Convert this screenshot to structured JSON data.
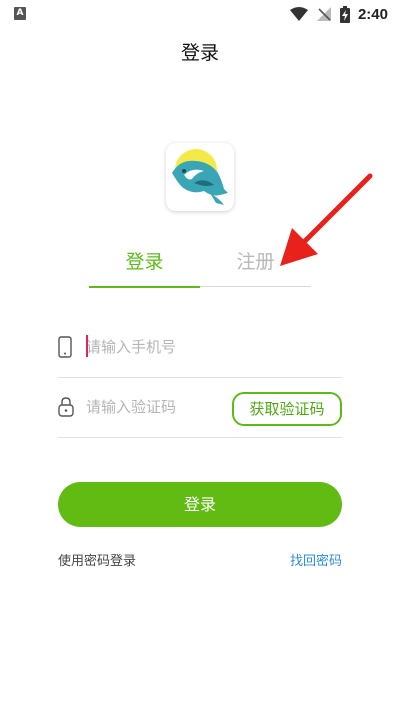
{
  "status_bar": {
    "left_icon": "A",
    "time": "2:40",
    "icons": [
      "wifi-icon",
      "no-signal-icon",
      "battery-charging-icon"
    ]
  },
  "header": {
    "title": "登录"
  },
  "logo": {
    "icon": "fish-app-logo-icon"
  },
  "tabs": [
    {
      "label": "登录",
      "active": true
    },
    {
      "label": "注册",
      "active": false
    }
  ],
  "annotation": {
    "icon": "red-arrow-icon",
    "color": "#e8221b"
  },
  "form": {
    "phone_placeholder": "请输入手机号",
    "code_placeholder": "请输入验证码",
    "get_code_label": "获取验证码",
    "submit_label": "登录"
  },
  "links": {
    "password_login": "使用密码登录",
    "forgot_password": "找回密码"
  },
  "colors": {
    "accent": "#62bb13",
    "link": "#2d8cd8",
    "inactive_tab": "#b8b8b8"
  }
}
